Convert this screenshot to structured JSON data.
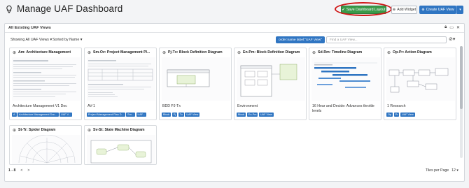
{
  "header": {
    "title": "Manage UAF Dashboard",
    "save_label": "Save Dashboard Layout",
    "add_label": "Add Widget",
    "create_label": "Create UAF View"
  },
  "panel": {
    "title": "All Existing UAF Views",
    "show_label": "Showing All UAF Views",
    "sort_label": "Sorted by Name",
    "filter_chip": "order:name label:\"UAF View\"",
    "search_placeholder": "Find a UAF View..."
  },
  "cards": [
    {
      "title": "Am: Architecture Management",
      "subtitle": "Architecture Management V1 Doc",
      "tags": [
        "A",
        "Architecture Management Doc...",
        "UAF V..."
      ]
    },
    {
      "title": "Sm-Ov: Project Management Pl...",
      "subtitle": "AV-1",
      "tags": [
        "Project Management Plan D...",
        "Sm...",
        "UAF..."
      ]
    },
    {
      "title": "Pj-Tx: Block Definition Diagram",
      "subtitle": "BDD PJ-Tx",
      "tags": [
        "Block",
        "Pj",
        "Tx",
        "UAF View"
      ]
    },
    {
      "title": "En-Pm: Block Definition Diagram",
      "subtitle": "Environment",
      "tags": [
        "Block",
        "En-Pm",
        "UAF View"
      ]
    },
    {
      "title": "Sd-Rm: Timeline Diagram",
      "subtitle": "16 Hear and Decide: Advances throttle levels",
      "tags": []
    },
    {
      "title": "Op-Pr: Action Diagram",
      "subtitle": "1 Research",
      "tags": [
        "Op",
        "Pr",
        "UAF View"
      ]
    },
    {
      "title": "St-Tr: Spider Diagram",
      "subtitle": "",
      "tags": []
    },
    {
      "title": "Sv-St: State Machine Diagram",
      "subtitle": "",
      "tags": []
    }
  ],
  "pager": {
    "range": "1 - 8",
    "prev": "<",
    "next": ">",
    "tiles_label": "Tiles per Page",
    "tiles_value": "12"
  },
  "colors": {
    "accent": "#2f75c2",
    "save": "#3a9a4a",
    "highlight": "#d01818"
  }
}
